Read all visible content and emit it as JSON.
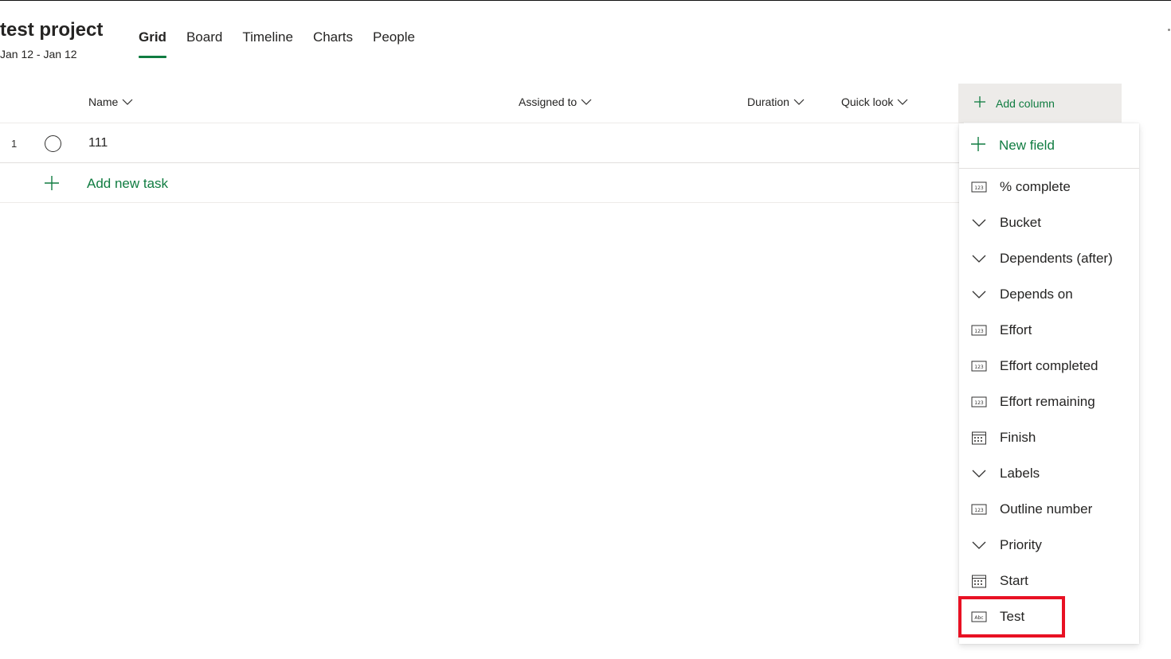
{
  "project": {
    "title": "test project",
    "dates": "Jan 12 - Jan 12"
  },
  "tabs": [
    {
      "label": "Grid",
      "active": true
    },
    {
      "label": "Board",
      "active": false
    },
    {
      "label": "Timeline",
      "active": false
    },
    {
      "label": "Charts",
      "active": false
    },
    {
      "label": "People",
      "active": false
    }
  ],
  "columns": {
    "name": "Name",
    "assigned_to": "Assigned to",
    "duration": "Duration",
    "quick_look": "Quick look",
    "add_column": "Add column"
  },
  "tasks": [
    {
      "number": "1",
      "name": "111"
    }
  ],
  "add_task_label": "Add new task",
  "dropdown": {
    "new_field": "New field",
    "items": [
      {
        "label": "% complete",
        "icon": "number-field-icon"
      },
      {
        "label": "Bucket",
        "icon": "chevron-down-icon"
      },
      {
        "label": "Dependents (after)",
        "icon": "chevron-down-icon"
      },
      {
        "label": "Depends on",
        "icon": "chevron-down-icon"
      },
      {
        "label": "Effort",
        "icon": "number-field-icon"
      },
      {
        "label": "Effort completed",
        "icon": "number-field-icon"
      },
      {
        "label": "Effort remaining",
        "icon": "number-field-icon"
      },
      {
        "label": "Finish",
        "icon": "calendar-icon"
      },
      {
        "label": "Labels",
        "icon": "chevron-down-icon"
      },
      {
        "label": "Outline number",
        "icon": "number-field-icon"
      },
      {
        "label": "Priority",
        "icon": "chevron-down-icon"
      },
      {
        "label": "Start",
        "icon": "calendar-icon"
      },
      {
        "label": "Test",
        "icon": "text-field-icon"
      }
    ]
  },
  "colors": {
    "accent": "#107c41",
    "highlight": "#e81123"
  }
}
